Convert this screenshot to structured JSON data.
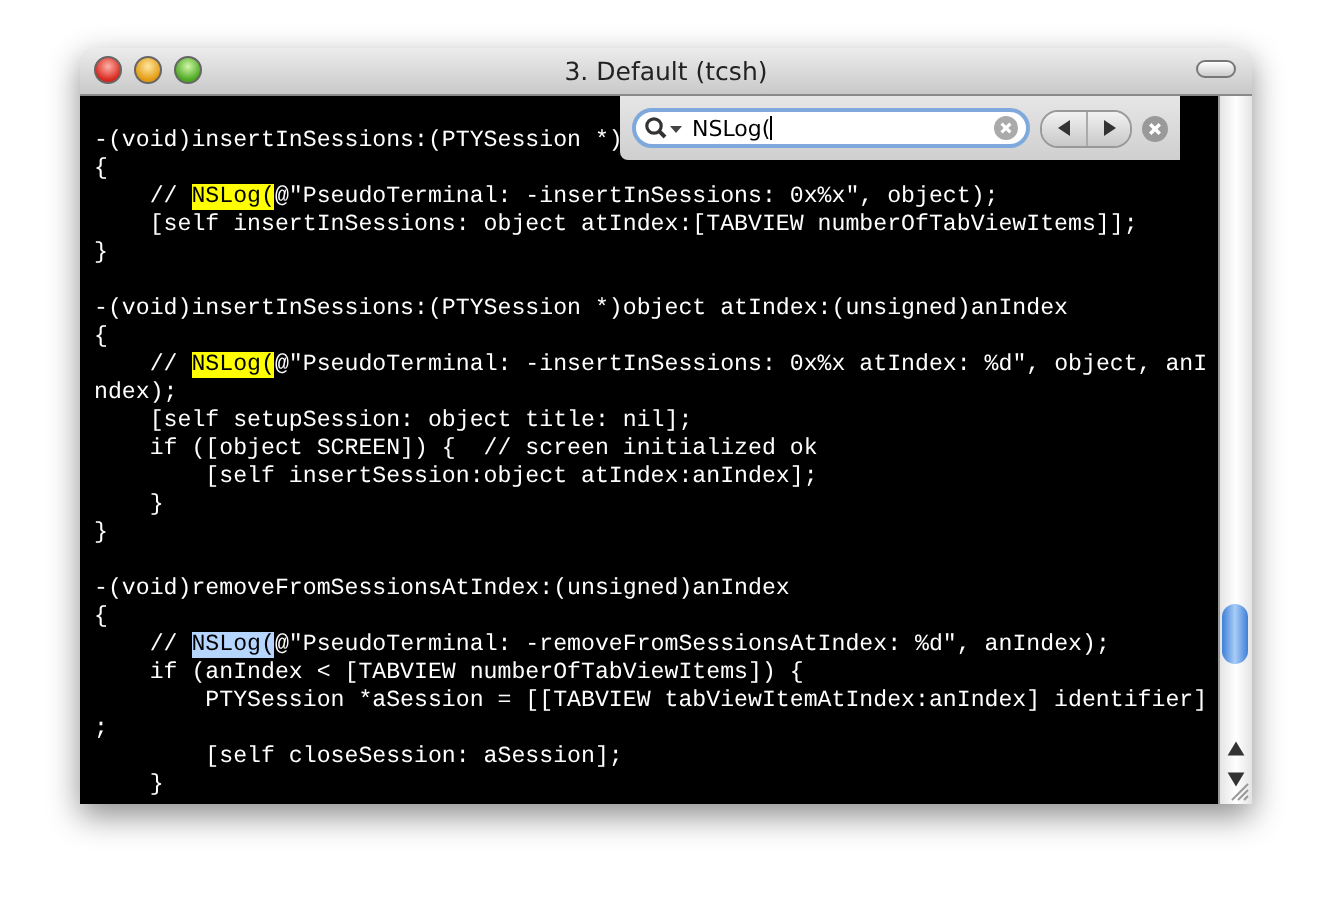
{
  "window": {
    "title": "3. Default (tcsh)"
  },
  "find_bar": {
    "value": "NSLog("
  },
  "lines": [
    {
      "kind": "blank"
    },
    {
      "kind": "code",
      "text": "-(void)insertInSessions:(PTYSession *)"
    },
    {
      "kind": "code",
      "text": "{"
    },
    {
      "kind": "match",
      "before": "    // ",
      "match": "NSLog(",
      "after": "@\"PseudoTerminal: -insertInSessions: 0x%x\", object);",
      "current": false
    },
    {
      "kind": "code",
      "text": "    [self insertInSessions: object atIndex:[TABVIEW numberOfTabViewItems]];"
    },
    {
      "kind": "code",
      "text": "}"
    },
    {
      "kind": "blank"
    },
    {
      "kind": "code",
      "text": "-(void)insertInSessions:(PTYSession *)object atIndex:(unsigned)anIndex"
    },
    {
      "kind": "code",
      "text": "{"
    },
    {
      "kind": "match",
      "before": "    // ",
      "match": "NSLog(",
      "after": "@\"PseudoTerminal: -insertInSessions: 0x%x atIndex: %d\", object, anI",
      "current": false
    },
    {
      "kind": "code",
      "text": "ndex);"
    },
    {
      "kind": "code",
      "text": "    [self setupSession: object title: nil];"
    },
    {
      "kind": "code",
      "text": "    if ([object SCREEN]) {  // screen initialized ok"
    },
    {
      "kind": "code",
      "text": "        [self insertSession:object atIndex:anIndex];"
    },
    {
      "kind": "code",
      "text": "    }"
    },
    {
      "kind": "code",
      "text": "}"
    },
    {
      "kind": "blank"
    },
    {
      "kind": "code",
      "text": "-(void)removeFromSessionsAtIndex:(unsigned)anIndex"
    },
    {
      "kind": "code",
      "text": "{"
    },
    {
      "kind": "match",
      "before": "    // ",
      "match": "NSLog(",
      "after": "@\"PseudoTerminal: -removeFromSessionsAtIndex: %d\", anIndex);",
      "current": true
    },
    {
      "kind": "code",
      "text": "    if (anIndex < [TABVIEW numberOfTabViewItems]) {"
    },
    {
      "kind": "code",
      "text": "        PTYSession *aSession = [[TABVIEW tabViewItemAtIndex:anIndex] identifier]"
    },
    {
      "kind": "code",
      "text": ";"
    },
    {
      "kind": "code",
      "text": "        [self closeSession: aSession];"
    },
    {
      "kind": "code",
      "text": "    }"
    }
  ]
}
